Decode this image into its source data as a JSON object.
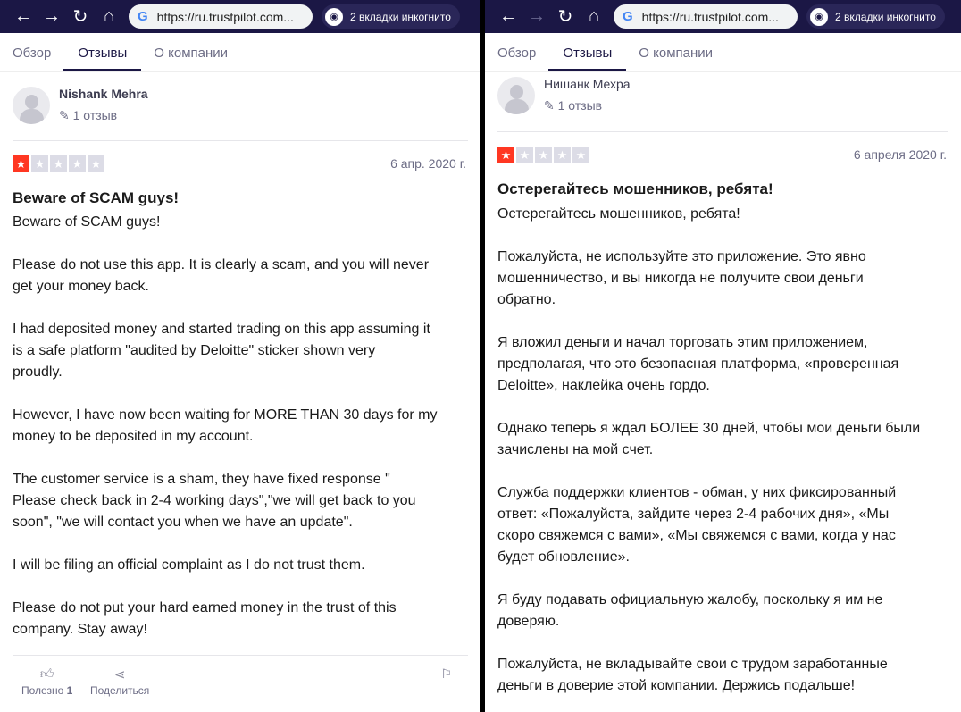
{
  "browser": {
    "url": "https://ru.trustpilot.com...",
    "incognito": "2 вкладки инкогнито"
  },
  "left": {
    "tabs": [
      "Обзор",
      "Отзывы",
      "О компании"
    ],
    "user": {
      "name": "Nishank Mehra",
      "reviews": "1 отзыв"
    },
    "rating": 1,
    "date": "6 апр. 2020 г.",
    "title": "Beware of SCAM guys!",
    "paragraphs": [
      [
        "Beware of SCAM guys!"
      ],
      [
        "Please do not use this app. It is clearly a scam, and you will never",
        "get your money back."
      ],
      [
        "I had deposited money and started trading on this app assuming it",
        "is a safe platform \"audited by Deloitte\" sticker shown very",
        "proudly."
      ],
      [
        "However, I have now been waiting for MORE THAN 30 days for my",
        "money to be deposited in my account."
      ],
      [
        "The customer service is a sham, they have fixed response \"",
        "Please check back in 2-4 working days\",\"we will get back to you",
        "soon\", \"we will contact you when we have an update\"."
      ],
      [
        "I will be filing an official complaint as I do not trust them."
      ],
      [
        "Please do not put your hard earned money in the trust of this",
        "company. Stay away!"
      ]
    ],
    "useful_label": "Полезно",
    "useful_count": "1",
    "share_label": "Поделиться"
  },
  "right": {
    "tabs": [
      "Обзор",
      "Отзывы",
      "О компании"
    ],
    "user": {
      "name": "Нишанк Мехра",
      "reviews": "1 отзыв"
    },
    "rating": 1,
    "date": "6 апреля 2020 г.",
    "title": "Остерегайтесь мошенников, ребята!",
    "paragraphs": [
      [
        "Остерегайтесь мошенников, ребята!"
      ],
      [
        "Пожалуйста, не используйте это приложение. Это явно",
        "мошенничество, и вы никогда не получите свои деньги",
        "обратно."
      ],
      [
        "Я вложил деньги и начал торговать этим приложением,",
        "предполагая, что это безопасная платформа, «проверенная",
        "Deloitte», наклейка очень гордо."
      ],
      [
        "Однако теперь я ждал БОЛЕЕ 30 дней, чтобы мои деньги были",
        "зачислены на мой счет."
      ],
      [
        "Служба поддержки клиентов - обман, у них фиксированный",
        "ответ: «Пожалуйста, зайдите через 2-4 рабочих дня», «Мы",
        "скоро свяжемся с вами», «Мы свяжемся с вами, когда у нас",
        "будет обновление»."
      ],
      [
        "Я буду подавать официальную жалобу, поскольку я им не",
        "доверяю."
      ],
      [
        "Пожалуйста, не вкладывайте свои с трудом заработанные",
        "деньги в доверие этой компании. Держись подальше!"
      ]
    ]
  }
}
